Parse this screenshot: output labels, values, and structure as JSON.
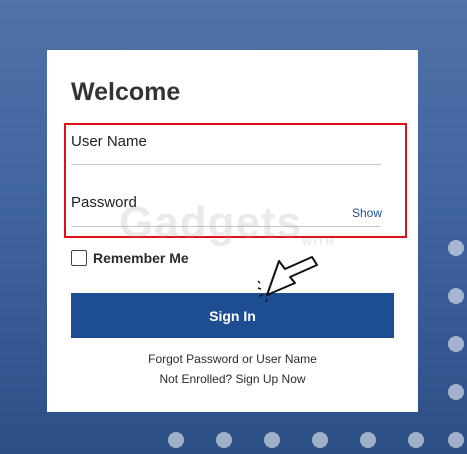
{
  "login": {
    "title": "Welcome",
    "username_label": "User Name",
    "password_label": "Password",
    "show_label": "Show",
    "remember_label": "Remember Me",
    "signin_label": "Sign In",
    "forgot_label": "Forgot Password or User Name",
    "enroll_label": "Not Enrolled? Sign Up Now"
  },
  "watermark": {
    "text": "Gadgets",
    "sub": "WITH"
  },
  "colors": {
    "background": "#3f64a0",
    "button": "#1e4e92",
    "highlight": "#e0101a"
  },
  "icons": [
    "pointer-arrow-icon",
    "checkbox"
  ]
}
